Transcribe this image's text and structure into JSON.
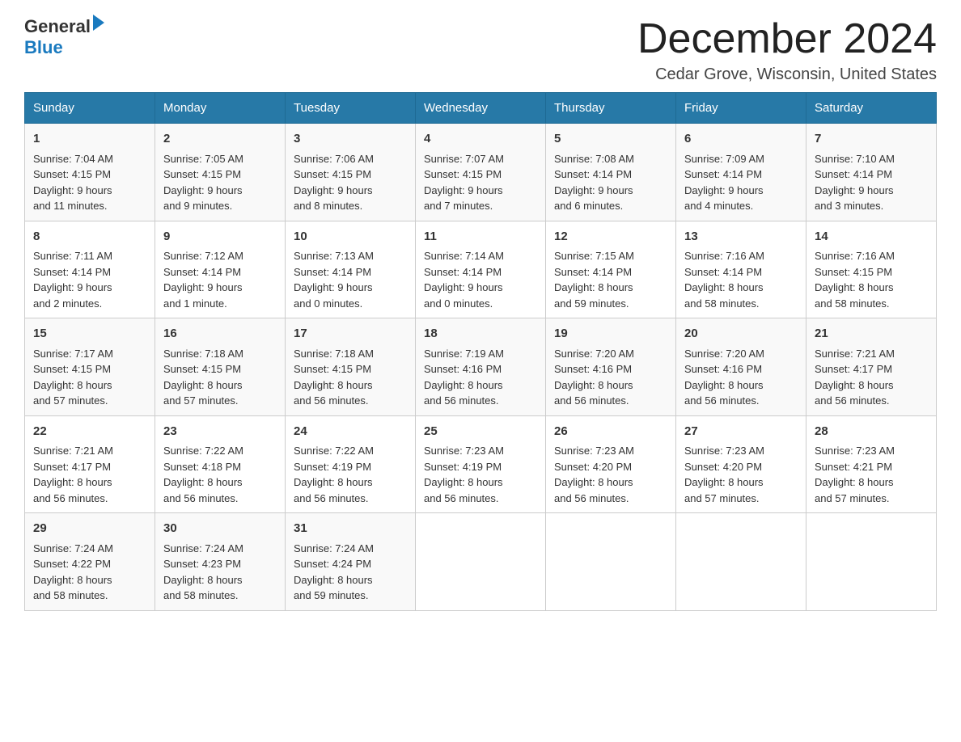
{
  "header": {
    "title": "December 2024",
    "location": "Cedar Grove, Wisconsin, United States",
    "logo_general": "General",
    "logo_blue": "Blue"
  },
  "days_of_week": [
    "Sunday",
    "Monday",
    "Tuesday",
    "Wednesday",
    "Thursday",
    "Friday",
    "Saturday"
  ],
  "weeks": [
    [
      {
        "day": "1",
        "sunrise": "7:04 AM",
        "sunset": "4:15 PM",
        "daylight": "9 hours and 11 minutes."
      },
      {
        "day": "2",
        "sunrise": "7:05 AM",
        "sunset": "4:15 PM",
        "daylight": "9 hours and 9 minutes."
      },
      {
        "day": "3",
        "sunrise": "7:06 AM",
        "sunset": "4:15 PM",
        "daylight": "9 hours and 8 minutes."
      },
      {
        "day": "4",
        "sunrise": "7:07 AM",
        "sunset": "4:15 PM",
        "daylight": "9 hours and 7 minutes."
      },
      {
        "day": "5",
        "sunrise": "7:08 AM",
        "sunset": "4:14 PM",
        "daylight": "9 hours and 6 minutes."
      },
      {
        "day": "6",
        "sunrise": "7:09 AM",
        "sunset": "4:14 PM",
        "daylight": "9 hours and 4 minutes."
      },
      {
        "day": "7",
        "sunrise": "7:10 AM",
        "sunset": "4:14 PM",
        "daylight": "9 hours and 3 minutes."
      }
    ],
    [
      {
        "day": "8",
        "sunrise": "7:11 AM",
        "sunset": "4:14 PM",
        "daylight": "9 hours and 2 minutes."
      },
      {
        "day": "9",
        "sunrise": "7:12 AM",
        "sunset": "4:14 PM",
        "daylight": "9 hours and 1 minute."
      },
      {
        "day": "10",
        "sunrise": "7:13 AM",
        "sunset": "4:14 PM",
        "daylight": "9 hours and 0 minutes."
      },
      {
        "day": "11",
        "sunrise": "7:14 AM",
        "sunset": "4:14 PM",
        "daylight": "9 hours and 0 minutes."
      },
      {
        "day": "12",
        "sunrise": "7:15 AM",
        "sunset": "4:14 PM",
        "daylight": "8 hours and 59 minutes."
      },
      {
        "day": "13",
        "sunrise": "7:16 AM",
        "sunset": "4:14 PM",
        "daylight": "8 hours and 58 minutes."
      },
      {
        "day": "14",
        "sunrise": "7:16 AM",
        "sunset": "4:15 PM",
        "daylight": "8 hours and 58 minutes."
      }
    ],
    [
      {
        "day": "15",
        "sunrise": "7:17 AM",
        "sunset": "4:15 PM",
        "daylight": "8 hours and 57 minutes."
      },
      {
        "day": "16",
        "sunrise": "7:18 AM",
        "sunset": "4:15 PM",
        "daylight": "8 hours and 57 minutes."
      },
      {
        "day": "17",
        "sunrise": "7:18 AM",
        "sunset": "4:15 PM",
        "daylight": "8 hours and 56 minutes."
      },
      {
        "day": "18",
        "sunrise": "7:19 AM",
        "sunset": "4:16 PM",
        "daylight": "8 hours and 56 minutes."
      },
      {
        "day": "19",
        "sunrise": "7:20 AM",
        "sunset": "4:16 PM",
        "daylight": "8 hours and 56 minutes."
      },
      {
        "day": "20",
        "sunrise": "7:20 AM",
        "sunset": "4:16 PM",
        "daylight": "8 hours and 56 minutes."
      },
      {
        "day": "21",
        "sunrise": "7:21 AM",
        "sunset": "4:17 PM",
        "daylight": "8 hours and 56 minutes."
      }
    ],
    [
      {
        "day": "22",
        "sunrise": "7:21 AM",
        "sunset": "4:17 PM",
        "daylight": "8 hours and 56 minutes."
      },
      {
        "day": "23",
        "sunrise": "7:22 AM",
        "sunset": "4:18 PM",
        "daylight": "8 hours and 56 minutes."
      },
      {
        "day": "24",
        "sunrise": "7:22 AM",
        "sunset": "4:19 PM",
        "daylight": "8 hours and 56 minutes."
      },
      {
        "day": "25",
        "sunrise": "7:23 AM",
        "sunset": "4:19 PM",
        "daylight": "8 hours and 56 minutes."
      },
      {
        "day": "26",
        "sunrise": "7:23 AM",
        "sunset": "4:20 PM",
        "daylight": "8 hours and 56 minutes."
      },
      {
        "day": "27",
        "sunrise": "7:23 AM",
        "sunset": "4:20 PM",
        "daylight": "8 hours and 57 minutes."
      },
      {
        "day": "28",
        "sunrise": "7:23 AM",
        "sunset": "4:21 PM",
        "daylight": "8 hours and 57 minutes."
      }
    ],
    [
      {
        "day": "29",
        "sunrise": "7:24 AM",
        "sunset": "4:22 PM",
        "daylight": "8 hours and 58 minutes."
      },
      {
        "day": "30",
        "sunrise": "7:24 AM",
        "sunset": "4:23 PM",
        "daylight": "8 hours and 58 minutes."
      },
      {
        "day": "31",
        "sunrise": "7:24 AM",
        "sunset": "4:24 PM",
        "daylight": "8 hours and 59 minutes."
      },
      null,
      null,
      null,
      null
    ]
  ],
  "labels": {
    "sunrise": "Sunrise:",
    "sunset": "Sunset:",
    "daylight": "Daylight:"
  }
}
